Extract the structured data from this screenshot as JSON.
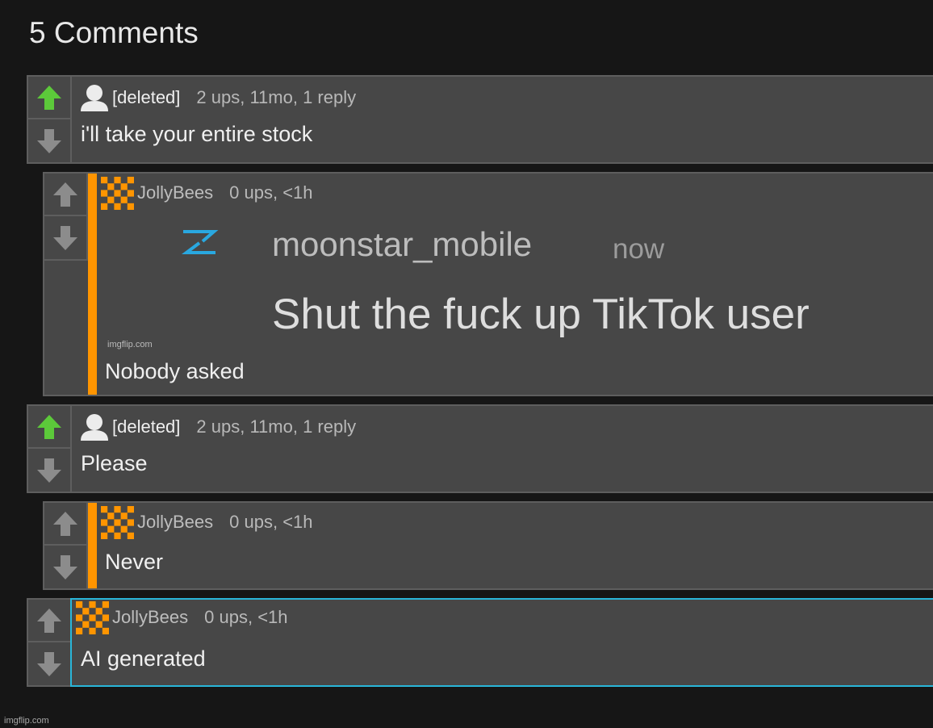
{
  "page": {
    "title": "5 Comments",
    "watermark": "imgflip.com"
  },
  "icons": {
    "upvote": "arrow-up-icon",
    "downvote": "arrow-down-icon",
    "deleted_avatar": "user-silhouette-icon",
    "user_avatar": "checker-avatar-icon"
  },
  "colors": {
    "background": "#161616",
    "comment_bg": "#474747",
    "upvote_active": "#5cc93a",
    "arrow_inactive": "#8c8c8c",
    "reply_bar": "#ff9500",
    "own_comment_border": "#29b6d9"
  },
  "comments": [
    {
      "username": "[deleted]",
      "meta": "2 ups, 11mo, 1 reply",
      "text": "i'll take your entire stock",
      "upvoted": true
    },
    {
      "username": "JollyBees",
      "meta": "0 ups, <1h",
      "text": "Nobody asked",
      "meme": {
        "user": "moonstar_mobile",
        "time": "now",
        "message": "Shut the fuck up TikTok user",
        "watermark": "imgflip.com"
      }
    },
    {
      "username": "[deleted]",
      "meta": "2 ups, 11mo, 1 reply",
      "text": "Please",
      "upvoted": true
    },
    {
      "username": "JollyBees",
      "meta": "0 ups, <1h",
      "text": "Never"
    },
    {
      "username": "JollyBees",
      "meta": "0 ups, <1h",
      "text": "AI generated"
    }
  ]
}
